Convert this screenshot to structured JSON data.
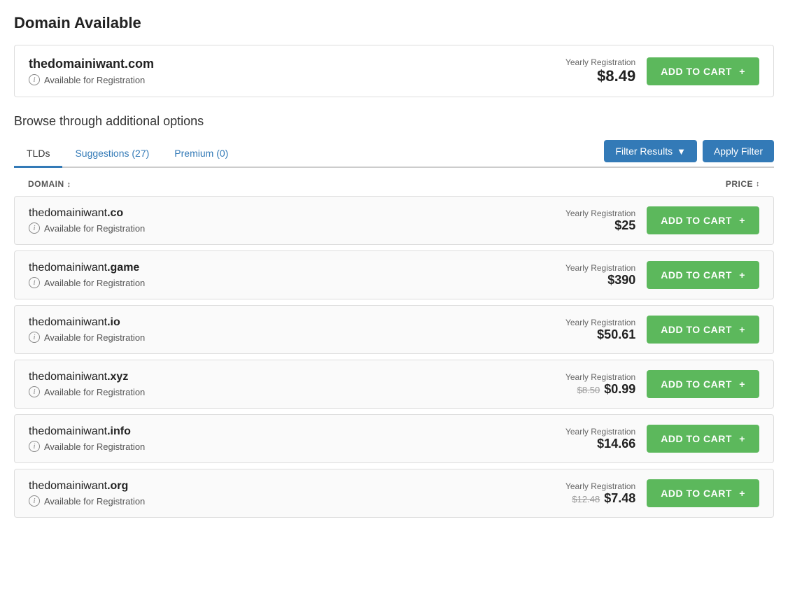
{
  "page": {
    "title": "Domain Available"
  },
  "featured": {
    "domain_base": "thedomainiwant",
    "domain_tld": ".com",
    "available_label": "Available for Registration",
    "price_label": "Yearly Registration",
    "price": "$8.49",
    "cart_button": "ADD TO CART"
  },
  "browse": {
    "title": "Browse through additional options"
  },
  "tabs": [
    {
      "label": "TLDs",
      "active": true
    },
    {
      "label": "Suggestions (27)",
      "active": false
    },
    {
      "label": "Premium (0)",
      "active": false
    }
  ],
  "filter_results_label": "Filter Results",
  "apply_filter_label": "Apply Filter",
  "table_headers": {
    "domain": "DOMAIN",
    "price": "PRICE"
  },
  "domains": [
    {
      "base": "thedomainiwant",
      "tld": ".co",
      "available_label": "Available for Registration",
      "price_label": "Yearly Registration",
      "price": "$25",
      "original_price": null,
      "cart_button": "ADD TO CART"
    },
    {
      "base": "thedomainiwant",
      "tld": ".game",
      "available_label": "Available for Registration",
      "price_label": "Yearly Registration",
      "price": "$390",
      "original_price": null,
      "cart_button": "ADD TO CART"
    },
    {
      "base": "thedomainiwant",
      "tld": ".io",
      "available_label": "Available for Registration",
      "price_label": "Yearly Registration",
      "price": "$50.61",
      "original_price": null,
      "cart_button": "ADD TO CART"
    },
    {
      "base": "thedomainiwant",
      "tld": ".xyz",
      "available_label": "Available for Registration",
      "price_label": "Yearly Registration",
      "price": "$0.99",
      "original_price": "$8.50",
      "cart_button": "ADD TO CART"
    },
    {
      "base": "thedomainiwant",
      "tld": ".info",
      "available_label": "Available for Registration",
      "price_label": "Yearly Registration",
      "price": "$14.66",
      "original_price": null,
      "cart_button": "ADD TO CART"
    },
    {
      "base": "thedomainiwant",
      "tld": ".org",
      "available_label": "Available for Registration",
      "price_label": "Yearly Registration",
      "price": "$7.48",
      "original_price": "$12.48",
      "cart_button": "ADD TO CART"
    }
  ]
}
